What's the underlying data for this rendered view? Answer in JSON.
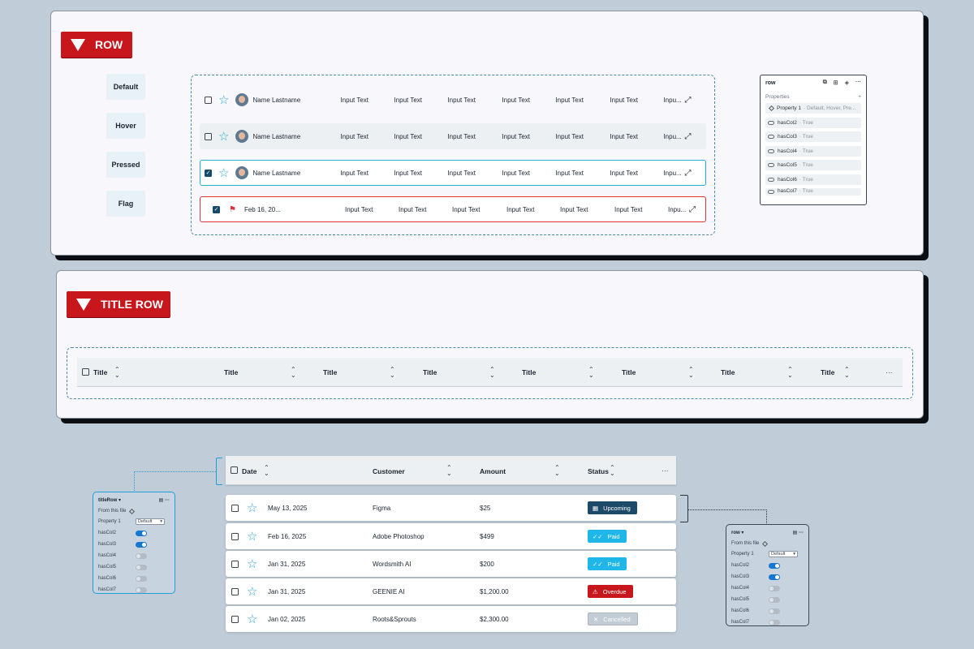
{
  "row_section": {
    "tag": "ROW",
    "states": [
      "Default",
      "Hover",
      "Pressed",
      "Flag"
    ],
    "person_name": "Name Lastname",
    "flag_date": "Feb 16, 20...",
    "cells": [
      "Input Text",
      "Input Text",
      "Input Text",
      "Input Text",
      "Input Text",
      "Input Text"
    ],
    "truncated_cell": "Inpu...",
    "panel": {
      "title": "row",
      "section": "Properties",
      "add": "+",
      "property1_label": "Property 1",
      "property1_value": "· Default, Hover, Pre...",
      "toggles": [
        {
          "name": "hasCol2",
          "value": "· True"
        },
        {
          "name": "hasCol3",
          "value": "· True"
        },
        {
          "name": "hasCol4",
          "value": "· True"
        },
        {
          "name": "hasCol5",
          "value": "· True"
        },
        {
          "name": "hasCol6",
          "value": "· True"
        },
        {
          "name": "hasCol7",
          "value": "· True"
        }
      ]
    }
  },
  "title_row_section": {
    "tag": "TITLE ROW",
    "titles": [
      "Title",
      "Title",
      "Title",
      "Title",
      "Title",
      "Title",
      "Title",
      "Title"
    ],
    "more": "···"
  },
  "table": {
    "columns": [
      "Date",
      "Customer",
      "Amount",
      "Status"
    ],
    "more": "···",
    "rows": [
      {
        "date": "May 13, 2025",
        "customer": "Figma",
        "amount": "$25",
        "status": "Upcoming",
        "status_color": "#1c4a68"
      },
      {
        "date": "Feb 16, 2025",
        "customer": "Adobe Photoshop",
        "amount": "$499",
        "status": "Paid",
        "status_color": "#1fb6ea"
      },
      {
        "date": "Jan 31, 2025",
        "customer": "Wordsmith AI",
        "amount": "$200",
        "status": "Paid",
        "status_color": "#1fb6ea"
      },
      {
        "date": "Jan 31, 2025",
        "customer": "GEENIE AI",
        "amount": "$1,200.00",
        "status": "Overdue",
        "status_color": "#c8161d"
      },
      {
        "date": "Jan 02, 2025",
        "customer": "Roots&Sprouts",
        "amount": "$2,300.00",
        "status": "Cancelled",
        "status_color": "#c3ccd5"
      }
    ]
  },
  "title_row_panel": {
    "title": "titleRow",
    "from_file": "From this file",
    "property1_label": "Property 1",
    "property1_value": "Default",
    "toggles": [
      {
        "name": "hasCol2",
        "on": true
      },
      {
        "name": "hasCol3",
        "on": true
      },
      {
        "name": "hasCol4",
        "on": false
      },
      {
        "name": "hasCol5",
        "on": false
      },
      {
        "name": "hasCol6",
        "on": false
      },
      {
        "name": "hasCol7",
        "on": false
      }
    ]
  },
  "row_panel": {
    "title": "row",
    "from_file": "From this file",
    "property1_label": "Property 1",
    "property1_value": "Default",
    "toggles": [
      {
        "name": "hasCol2",
        "on": true
      },
      {
        "name": "hasCol3",
        "on": true
      },
      {
        "name": "hasCol4",
        "on": false
      },
      {
        "name": "hasCol5",
        "on": false
      },
      {
        "name": "hasCol6",
        "on": false
      },
      {
        "name": "hasCol7",
        "on": false
      }
    ]
  }
}
